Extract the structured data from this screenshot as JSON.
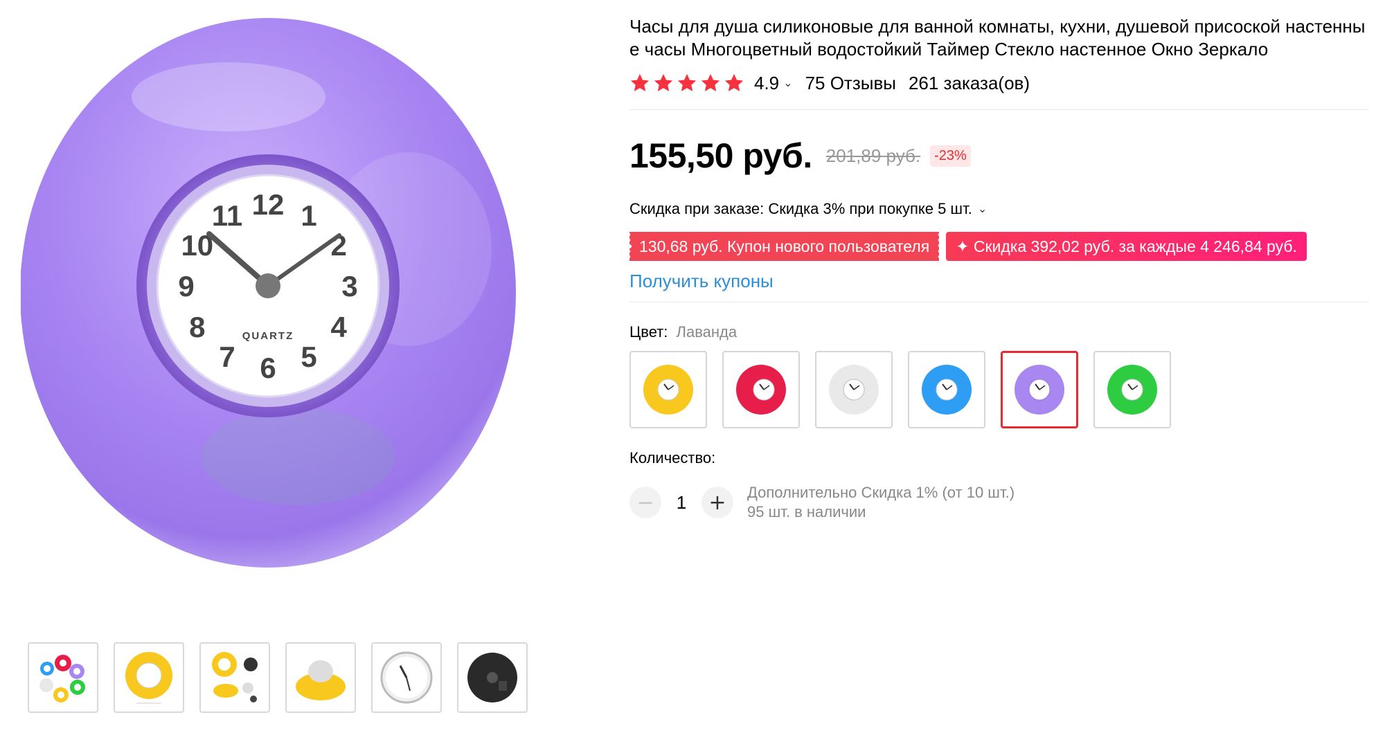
{
  "product": {
    "title": "Часы для душа силиконовые для ванной комнаты, кухни, душевой присоской настенные часы Многоцветный водостойкий Таймер Стекло настенное Окно Зеркало"
  },
  "rating": {
    "value": "4.9",
    "reviews": "75 Отзывы",
    "orders": "261 заказа(ов)",
    "star_color": "#f7323f"
  },
  "price": {
    "current": "155,50 руб.",
    "old": "201,89 руб.",
    "discount": "-23%"
  },
  "bulk_discount": "Скидка при заказе: Скидка 3% при покупке 5 шт.",
  "coupons": {
    "new_user": "130,68 руб. Купон нового пользователя",
    "store": "✦ Скидка 392,02 руб. за каждые 4 246,84 руб.",
    "get_link": "Получить купоны"
  },
  "color": {
    "label": "Цвет:",
    "selected": "Лаванда",
    "options": [
      "yellow",
      "red",
      "white",
      "blue",
      "lavender",
      "green"
    ]
  },
  "quantity": {
    "label": "Количество:",
    "value": "1",
    "minus": "−",
    "plus": "+",
    "extra_discount": "Дополнительно Скидка 1% (от 10 шт.)",
    "stock": "95 шт. в наличии"
  },
  "clock_face": {
    "numbers": [
      "12",
      "1",
      "2",
      "3",
      "4",
      "5",
      "6",
      "7",
      "8",
      "9",
      "10",
      "11"
    ],
    "brand": "QUARTZ"
  },
  "colors": {
    "accent_red": "#e8292e",
    "link_blue": "#2d8ed8",
    "coupon_red": "#f24454",
    "coupon_pink": "#ff1f7a",
    "lavender": "#a887f0"
  }
}
